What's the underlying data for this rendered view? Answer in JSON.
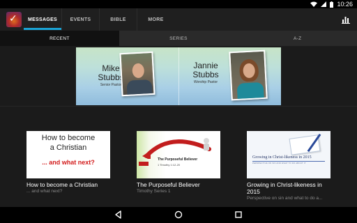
{
  "status_bar": {
    "time": "10:26",
    "icons": [
      "wifi-icon",
      "signal-icon",
      "battery-icon"
    ]
  },
  "app_bar": {
    "logo": "church-app-logo",
    "tabs": [
      {
        "label": "MESSAGES",
        "active": true
      },
      {
        "label": "EVENTS",
        "active": false
      },
      {
        "label": "BIBLE",
        "active": false
      },
      {
        "label": "MORE",
        "active": false
      }
    ],
    "action_icon": "bar-chart-icon"
  },
  "sub_tabs": [
    {
      "label": "RECENT",
      "active": true
    },
    {
      "label": "SERIES",
      "active": false
    },
    {
      "label": "A-Z",
      "active": false
    }
  ],
  "banner": {
    "people": [
      {
        "name_line1": "Mike",
        "name_line2": "Stubbs",
        "role": "Senior Pastor"
      },
      {
        "name_line1": "Jannie",
        "name_line2": "Stubbs",
        "role": "Worship Pastor"
      }
    ]
  },
  "cards": [
    {
      "title": "How to become a Christian",
      "subtitle": "... and what next?",
      "thumb": {
        "line1": "How to become",
        "line2": "a Christian",
        "line3": "... and what next?"
      }
    },
    {
      "title": "The Purposeful Believer",
      "subtitle": "Timothy Series 1",
      "thumb": {
        "title": "The Purposeful Believer",
        "ref": "1 Timothy 1:12-20"
      }
    },
    {
      "title": "Growing in Christ-likeness in 2015",
      "subtitle": "Perspective on sin and what to do a...",
      "thumb": {
        "title": "Growing in Christ-likeness in 2015",
        "sub": "PERSPECTIVE ON SIN AND WHAT TO DO ABOUT IT"
      }
    }
  ],
  "colors": {
    "accent": "#1aa5d7",
    "background": "#1b1b1b",
    "appbar": "#1f1f1f"
  },
  "nav_bar": {
    "icons": [
      "back-icon",
      "home-icon",
      "recent-apps-icon"
    ]
  }
}
